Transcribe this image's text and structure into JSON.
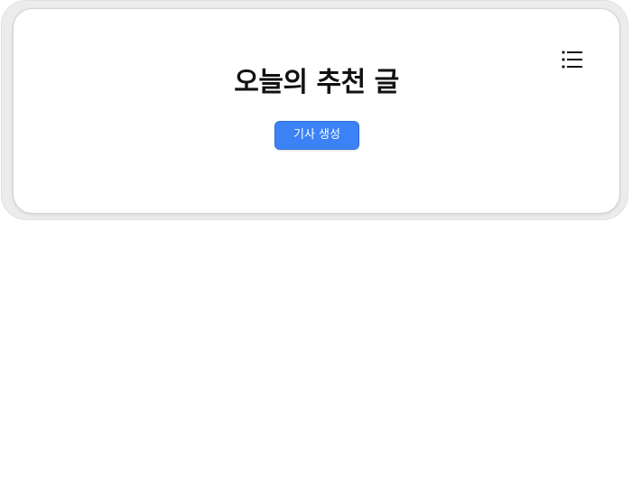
{
  "header": {
    "title": "오늘의 추천 글",
    "menu_icon": "list-menu-icon"
  },
  "actions": {
    "generate_label": "기사 생성"
  },
  "colors": {
    "accent": "#3b82f6",
    "title_text": "#111111",
    "background": "#ffffff"
  }
}
